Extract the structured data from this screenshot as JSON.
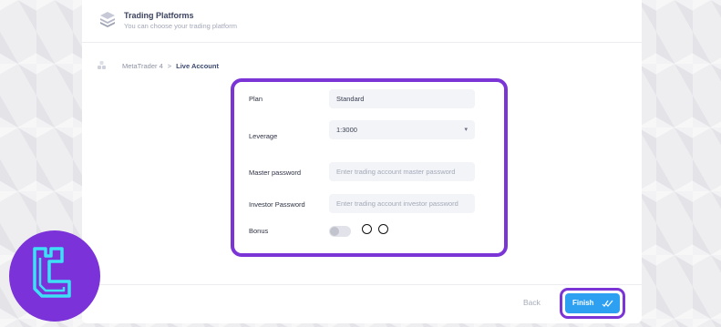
{
  "header": {
    "title": "Trading Platforms",
    "subtitle": "You can choose your trading platform",
    "icon": "layers-icon"
  },
  "breadcrumb": {
    "icon": "blocks-icon",
    "items": [
      "MetaTrader 4",
      "Live Account"
    ],
    "separator": ">"
  },
  "form": {
    "plan": {
      "label": "Plan",
      "value": "Standard"
    },
    "leverage": {
      "label": "Leverage",
      "value": "1:3000",
      "icon": "chevron-down-icon"
    },
    "master_password": {
      "label": "Master password",
      "placeholder": "Enter trading account master password"
    },
    "investor_password": {
      "label": "Investor Password",
      "placeholder": "Enter trading account investor password"
    },
    "bonus": {
      "label": "Bonus",
      "enabled": false
    }
  },
  "footer": {
    "back_label": "Back",
    "finish_label": "Finish",
    "finish_icon": "double-check-icon"
  },
  "colors": {
    "highlight": "#7b35d6",
    "accent": "#2da0f2",
    "logo_bg": "#7b32d9",
    "logo_stroke": "#3de0f5"
  },
  "logo": {
    "icon": "tradingfinder-logo-icon"
  }
}
